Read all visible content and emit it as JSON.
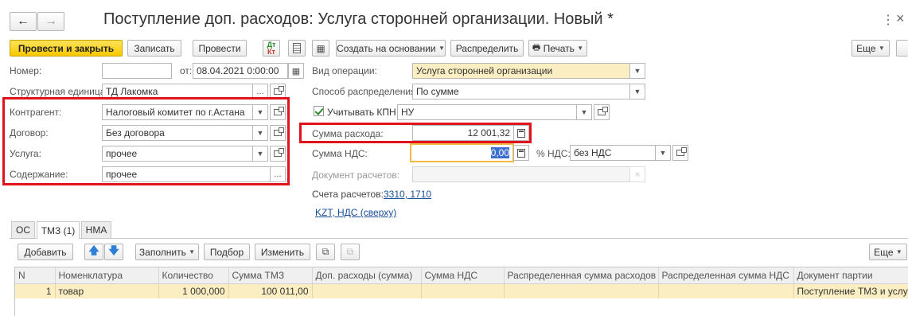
{
  "window": {
    "title": "Поступление доп. расходов: Услуга сторонней организации. Новый *"
  },
  "toolbar": {
    "post_close": "Провести и закрыть",
    "write": "Записать",
    "post": "Провести",
    "dt_kt_top": "Дт",
    "dt_kt_bottom": "Кт",
    "create_based": "Создать на основании",
    "distribute": "Распределить",
    "print": "Печать",
    "more": "Еще"
  },
  "form": {
    "number_label": "Номер:",
    "number_value": "",
    "date_label": "от:",
    "date_value": "08.04.2021  0:00:00",
    "unit_label": "Структурная единица:",
    "unit_value": "ТД Лакомка",
    "contractor_label": "Контрагент:",
    "contractor_value": "Налоговый комитет по г.Астана",
    "contract_label": "Договор:",
    "contract_value": "Без договора",
    "service_label": "Услуга:",
    "service_value": "прочее",
    "content_label": "Содержание:",
    "content_value": "прочее",
    "op_type_label": "Вид операции:",
    "op_type_value": "Услуга сторонней организации",
    "dist_method_label": "Способ распределения:",
    "dist_method_value": "По сумме",
    "kpn_label": "Учитывать КПН",
    "kpn_checked": true,
    "kpn_value": "НУ",
    "expense_sum_label": "Сумма расхода:",
    "expense_sum_value": "12 001,32",
    "vat_sum_label": "Сумма НДС:",
    "vat_sum_value": "0,00",
    "vat_rate_label": "% НДС:",
    "vat_rate_value": "без НДС",
    "settlement_doc_label": "Документ расчетов:",
    "settlement_doc_value": "",
    "accounts_label": "Счета расчетов:",
    "accounts_link": "3310, 1710",
    "currency_link": "KZT, НДС (сверху)"
  },
  "tabs": [
    {
      "label": "ОС",
      "active": false
    },
    {
      "label": "ТМЗ (1)",
      "active": true
    },
    {
      "label": "НМА",
      "active": false
    }
  ],
  "table_toolbar": {
    "add": "Добавить",
    "fill": "Заполнить",
    "select": "Подбор",
    "change": "Изменить",
    "more": "Еще"
  },
  "table": {
    "columns": [
      "N",
      "Номенклатура",
      "Количество",
      "Сумма ТМЗ",
      "Доп. расходы (сумма)",
      "Сумма НДС",
      "Распределенная сумма расходов",
      "Распределенная сумма НДС",
      "Документ партии"
    ],
    "rows": [
      [
        "1",
        "товар",
        "1 000,000",
        "100 011,00",
        "",
        "",
        "",
        "",
        "Поступление ТМЗ и услуг"
      ]
    ]
  },
  "colors": {
    "primary_button": "#f7c800",
    "highlight_box": "#e0131d",
    "selected_row": "#fbeec2",
    "link": "#1a4e96"
  }
}
